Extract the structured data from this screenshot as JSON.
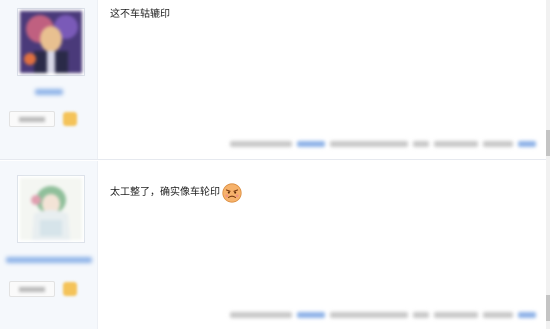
{
  "posts": [
    {
      "username": "",
      "level_label": "",
      "content": "这不车轱辘印",
      "meta": ""
    },
    {
      "username": "",
      "level_label": "",
      "content": "太工整了，确实像车轮印",
      "emoji": "angry-face-emoji",
      "meta": ""
    }
  ],
  "colors": {
    "sidebar_bg": "#f5f8fc",
    "link_blue": "#8fb3e8",
    "level_badge": "#f4c35a"
  }
}
